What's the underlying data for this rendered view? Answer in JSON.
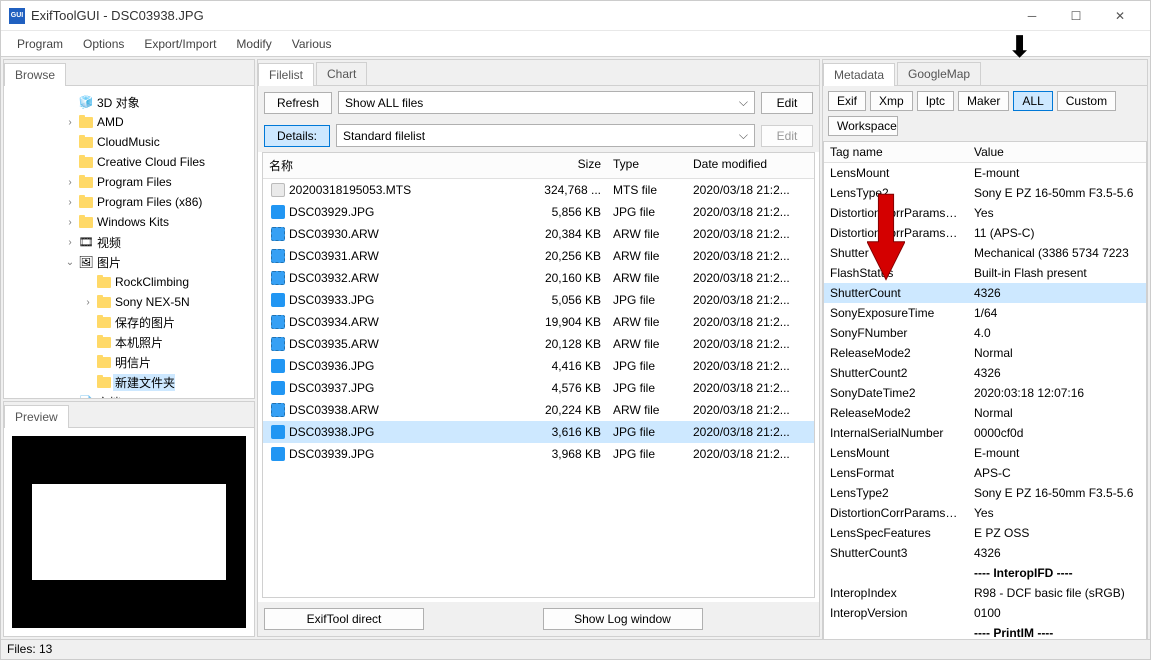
{
  "title": "ExifToolGUI - DSC03938.JPG",
  "menus": [
    "Program",
    "Options",
    "Export/Import",
    "Modify",
    "Various"
  ],
  "browse": {
    "tab": "Browse",
    "tree": [
      {
        "depth": 0,
        "arrow": "",
        "icon": "3d",
        "label": "3D 对象"
      },
      {
        "depth": 0,
        "arrow": ">",
        "icon": "folder",
        "label": "AMD"
      },
      {
        "depth": 0,
        "arrow": "",
        "icon": "folder",
        "label": "CloudMusic"
      },
      {
        "depth": 0,
        "arrow": "",
        "icon": "folder",
        "label": "Creative Cloud Files"
      },
      {
        "depth": 0,
        "arrow": ">",
        "icon": "folder",
        "label": "Program Files"
      },
      {
        "depth": 0,
        "arrow": ">",
        "icon": "folder",
        "label": "Program Files (x86)"
      },
      {
        "depth": 0,
        "arrow": ">",
        "icon": "folder",
        "label": "Windows Kits"
      },
      {
        "depth": 0,
        "arrow": ">",
        "icon": "video",
        "label": "视频"
      },
      {
        "depth": 0,
        "arrow": "v",
        "icon": "pic",
        "label": "图片"
      },
      {
        "depth": 1,
        "arrow": "",
        "icon": "folder",
        "label": "RockClimbing"
      },
      {
        "depth": 1,
        "arrow": ">",
        "icon": "folder",
        "label": "Sony NEX-5N"
      },
      {
        "depth": 1,
        "arrow": "",
        "icon": "folder",
        "label": "保存的图片"
      },
      {
        "depth": 1,
        "arrow": "",
        "icon": "folder",
        "label": "本机照片"
      },
      {
        "depth": 1,
        "arrow": "",
        "icon": "folder",
        "label": "明信片"
      },
      {
        "depth": 1,
        "arrow": "",
        "icon": "folder",
        "label": "新建文件夹",
        "sel": true
      },
      {
        "depth": 0,
        "arrow": ">",
        "icon": "doc",
        "label": "文档"
      }
    ]
  },
  "preview": {
    "tab": "Preview"
  },
  "filelist": {
    "tabs": [
      "Filelist",
      "Chart"
    ],
    "activeTab": 0,
    "refresh": "Refresh",
    "showAll": "Show ALL files",
    "edit1": "Edit",
    "details": "Details:",
    "stdFilelist": "Standard filelist",
    "edit2": "Edit",
    "cols": {
      "name": "名称",
      "size": "Size",
      "type": "Type",
      "date": "Date modified"
    },
    "rows": [
      {
        "icon": "mts",
        "name": "20200318195053.MTS",
        "size": "324,768 ...",
        "type": "MTS file",
        "date": "2020/03/18 21:2..."
      },
      {
        "icon": "jpg",
        "name": "DSC03929.JPG",
        "size": "5,856 KB",
        "type": "JPG file",
        "date": "2020/03/18 21:2..."
      },
      {
        "icon": "arw",
        "name": "DSC03930.ARW",
        "size": "20,384 KB",
        "type": "ARW file",
        "date": "2020/03/18 21:2..."
      },
      {
        "icon": "arw",
        "name": "DSC03931.ARW",
        "size": "20,256 KB",
        "type": "ARW file",
        "date": "2020/03/18 21:2..."
      },
      {
        "icon": "arw",
        "name": "DSC03932.ARW",
        "size": "20,160 KB",
        "type": "ARW file",
        "date": "2020/03/18 21:2..."
      },
      {
        "icon": "jpg",
        "name": "DSC03933.JPG",
        "size": "5,056 KB",
        "type": "JPG file",
        "date": "2020/03/18 21:2..."
      },
      {
        "icon": "arw",
        "name": "DSC03934.ARW",
        "size": "19,904 KB",
        "type": "ARW file",
        "date": "2020/03/18 21:2..."
      },
      {
        "icon": "arw",
        "name": "DSC03935.ARW",
        "size": "20,128 KB",
        "type": "ARW file",
        "date": "2020/03/18 21:2..."
      },
      {
        "icon": "jpg",
        "name": "DSC03936.JPG",
        "size": "4,416 KB",
        "type": "JPG file",
        "date": "2020/03/18 21:2..."
      },
      {
        "icon": "jpg",
        "name": "DSC03937.JPG",
        "size": "4,576 KB",
        "type": "JPG file",
        "date": "2020/03/18 21:2..."
      },
      {
        "icon": "arw",
        "name": "DSC03938.ARW",
        "size": "20,224 KB",
        "type": "ARW file",
        "date": "2020/03/18 21:2..."
      },
      {
        "icon": "jpg",
        "name": "DSC03938.JPG",
        "size": "3,616 KB",
        "type": "JPG file",
        "date": "2020/03/18 21:2...",
        "sel": true
      },
      {
        "icon": "jpg",
        "name": "DSC03939.JPG",
        "size": "3,968 KB",
        "type": "JPG file",
        "date": "2020/03/18 21:2..."
      }
    ],
    "exifToolDirect": "ExifTool direct",
    "showLog": "Show Log window"
  },
  "metadata": {
    "tabs": [
      "Metadata",
      "GoogleMap"
    ],
    "buttons": [
      "Exif",
      "Xmp",
      "Iptc",
      "Maker",
      "ALL",
      "Custom"
    ],
    "selectedBtn": 4,
    "workspace": "Workspace",
    "cols": {
      "name": "Tag name",
      "value": "Value"
    },
    "rows": [
      {
        "n": "LensMount",
        "v": "E-mount"
      },
      {
        "n": "LensType2",
        "v": "Sony E PZ 16-50mm F3.5-5.6"
      },
      {
        "n": "DistortionCorrParamsPrese",
        "v": "Yes"
      },
      {
        "n": "DistortionCorrParamsNum",
        "v": "11 (APS-C)"
      },
      {
        "n": "Shutter",
        "v": "Mechanical (3386 5734 7223"
      },
      {
        "n": "FlashStatus",
        "v": "Built-in Flash present"
      },
      {
        "n": "ShutterCount",
        "v": "4326",
        "sel": true
      },
      {
        "n": "SonyExposureTime",
        "v": "1/64"
      },
      {
        "n": "SonyFNumber",
        "v": "4.0"
      },
      {
        "n": "ReleaseMode2",
        "v": "Normal"
      },
      {
        "n": "ShutterCount2",
        "v": "4326"
      },
      {
        "n": "SonyDateTime2",
        "v": "2020:03:18 12:07:16"
      },
      {
        "n": "ReleaseMode2",
        "v": "Normal"
      },
      {
        "n": "InternalSerialNumber",
        "v": "0000cf0d"
      },
      {
        "n": "LensMount",
        "v": "E-mount"
      },
      {
        "n": "LensFormat",
        "v": "APS-C"
      },
      {
        "n": "LensType2",
        "v": "Sony E PZ 16-50mm F3.5-5.6"
      },
      {
        "n": "DistortionCorrParamsPrese",
        "v": "Yes"
      },
      {
        "n": "LensSpecFeatures",
        "v": "E PZ OSS"
      },
      {
        "n": "ShutterCount3",
        "v": "4326"
      },
      {
        "n": "",
        "v": "---- InteropIFD ----",
        "sep": true
      },
      {
        "n": "InteropIndex",
        "v": "R98 - DCF basic file (sRGB)"
      },
      {
        "n": "InteropVersion",
        "v": "0100"
      },
      {
        "n": "",
        "v": "---- PrintIM ----",
        "sep": true
      }
    ]
  },
  "status": "Files: 13"
}
